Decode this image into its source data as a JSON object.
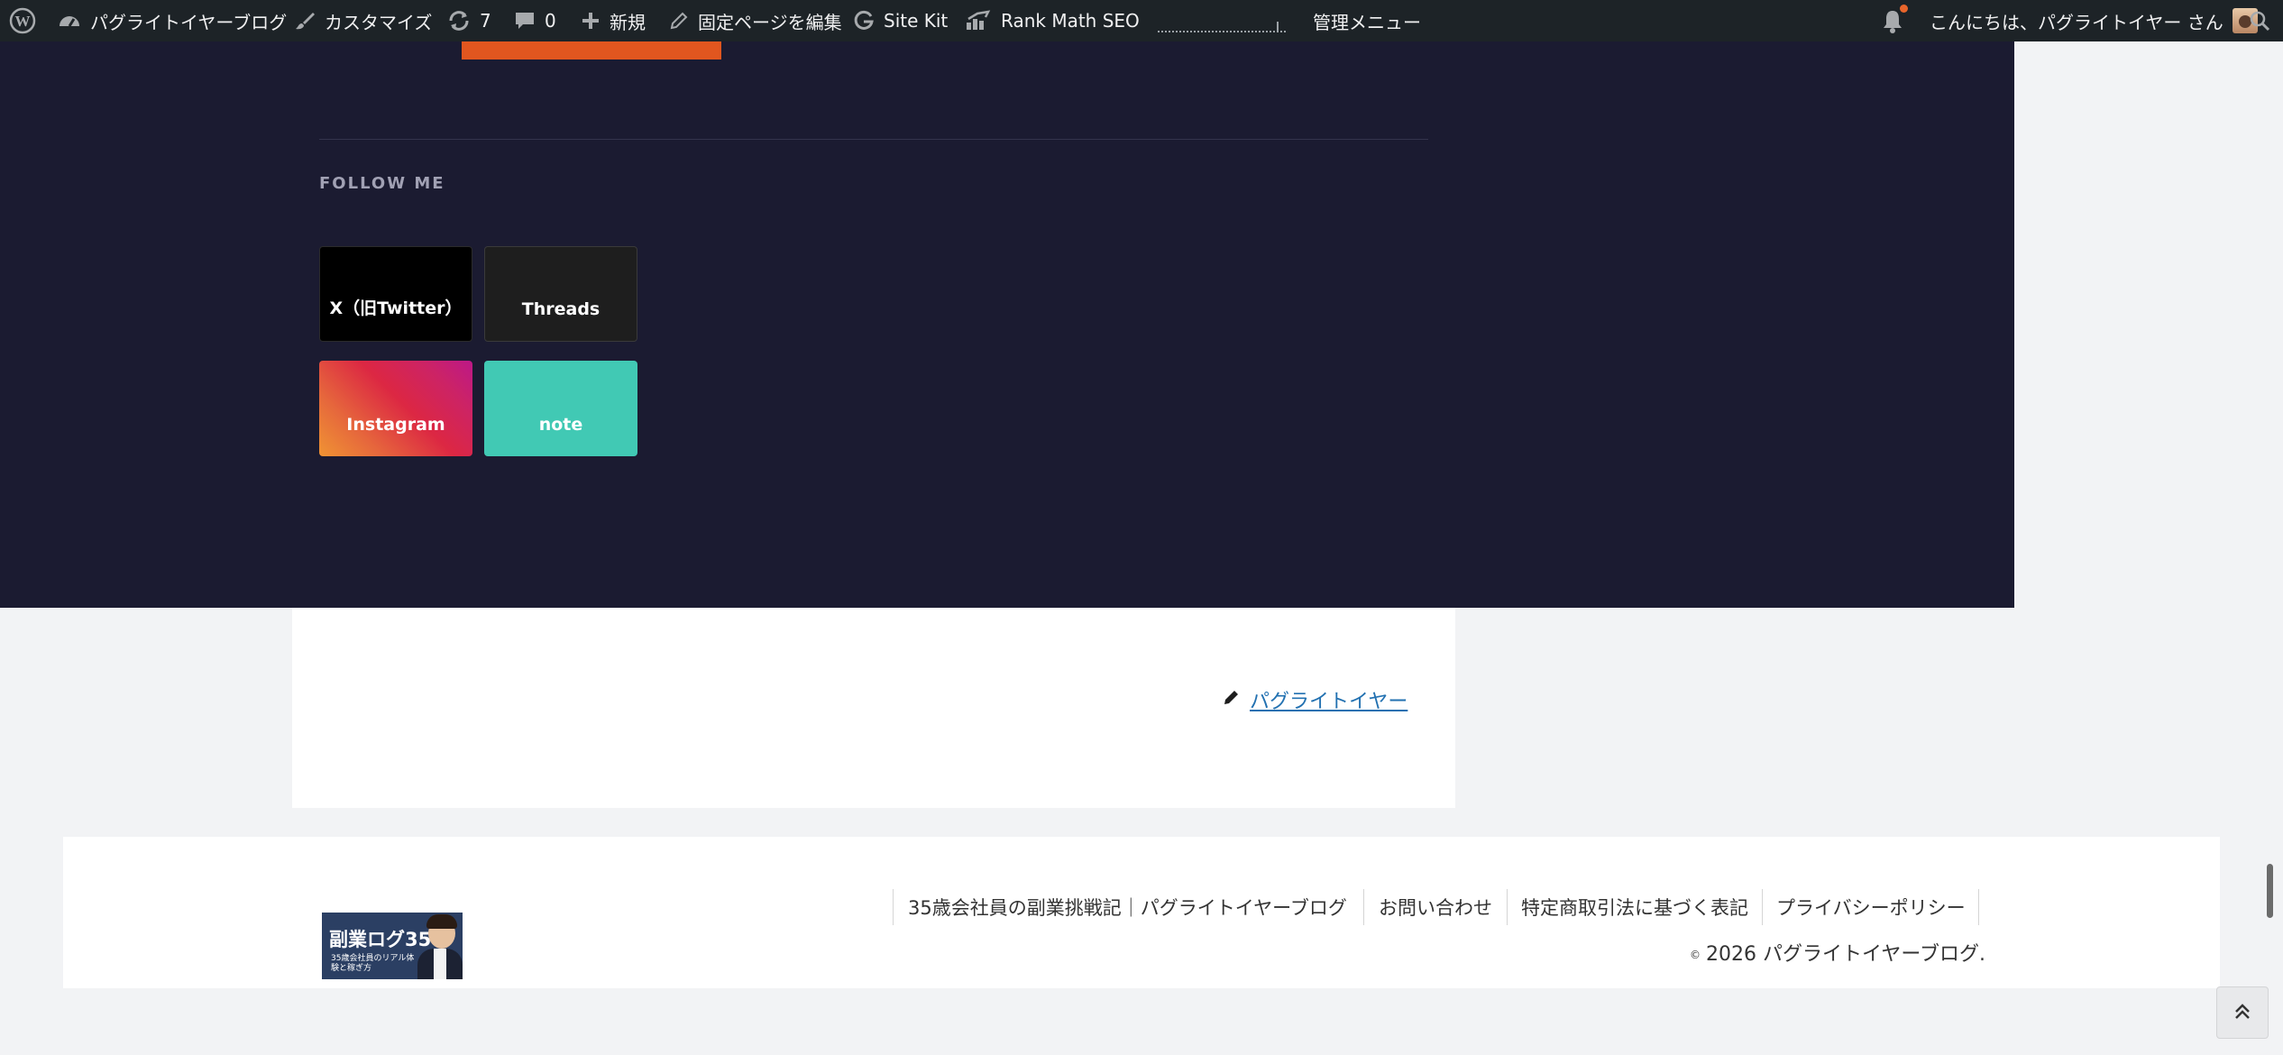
{
  "adminbar": {
    "site_name": "パグライトイヤーブログ",
    "customize": "カスタマイズ",
    "updates_count": "7",
    "comments_count": "0",
    "new_label": "新規",
    "edit_page": "固定ページを編集",
    "site_kit": "Site Kit",
    "rank_math": "Rank Math SEO",
    "admin_menu": "管理メニュー",
    "greeting": "こんにちは、パグライトイヤー さん"
  },
  "follow": {
    "title": "FOLLOW ME",
    "links": [
      {
        "label": "X（旧Twitter）"
      },
      {
        "label": "Threads"
      },
      {
        "label": "Instagram"
      },
      {
        "label": "note"
      }
    ]
  },
  "article": {
    "author": "パグライトイヤー"
  },
  "footer": {
    "logo": {
      "main": "副業ログ35",
      "sub": "35歳会社員のリアル体験と稼ぎ方"
    },
    "nav": [
      {
        "label": "35歳会社員の副業挑戦記｜パグライトイヤーブログ"
      },
      {
        "label": "お問い合わせ"
      },
      {
        "label": "特定商取引法に基づく表記"
      },
      {
        "label": "プライバシーポリシー"
      }
    ],
    "copyright_symbol": "©",
    "copyright": "2026 パグライトイヤーブログ."
  },
  "icons": {
    "wordpress": "wordpress-icon",
    "dashboard": "dashboard-icon",
    "customize": "brush-icon",
    "updates": "refresh-icon",
    "comments": "comment-icon",
    "new": "plus-icon",
    "edit": "pencil-icon",
    "sitekit": "google-g-icon",
    "rankmath": "rank-math-icon",
    "notifications": "bell-icon",
    "search": "search-icon",
    "author": "pencil-icon",
    "to_top": "double-chevron-up-icon"
  },
  "colors": {
    "adminbar_bg": "#1d2327",
    "dark_band": "#1b1b31",
    "orange_accent": "#e1561f",
    "note_green": "#41c9b4",
    "link_blue": "#2271b1"
  }
}
